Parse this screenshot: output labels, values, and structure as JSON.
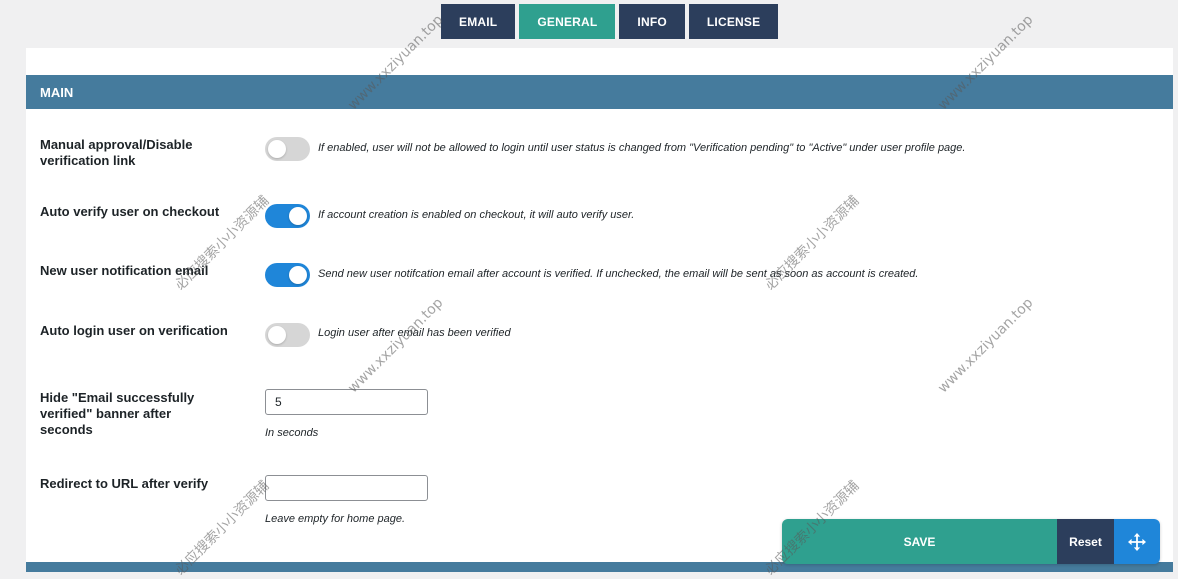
{
  "tabs": [
    {
      "label": "EMAIL",
      "active": false
    },
    {
      "label": "GENERAL",
      "active": true
    },
    {
      "label": "INFO",
      "active": false
    },
    {
      "label": "LICENSE",
      "active": false
    }
  ],
  "section": {
    "title": "MAIN"
  },
  "settings": {
    "manual_approval": {
      "label": "Manual approval/Disable verification link",
      "enabled": false,
      "description": "If enabled, user will not be allowed to login until user status is changed from \"Verification pending\" to \"Active\" under user profile page."
    },
    "auto_verify": {
      "label": "Auto verify user on checkout",
      "enabled": true,
      "description": "If account creation is enabled on checkout, it will auto verify user."
    },
    "new_user_notification": {
      "label": "New user notification email",
      "enabled": true,
      "description": "Send new user notifcation email after account is verified. If unchecked, the email will be sent as soon as account is created."
    },
    "auto_login": {
      "label": "Auto login user on verification",
      "enabled": false,
      "description": "Login user after email has been verified"
    },
    "hide_banner": {
      "label": "Hide \"Email successfully verified\" banner after seconds",
      "value": "5",
      "hint": "In seconds"
    },
    "redirect_url": {
      "label": "Redirect to URL after verify",
      "value": "",
      "hint": "Leave empty for home page."
    }
  },
  "actions": {
    "save_label": "SAVE",
    "reset_label": "Reset",
    "move_icon": "move-arrows-icon"
  },
  "watermarks": {
    "site": "www.xxziyuan.top",
    "cn": "必应搜索小小资源辅"
  },
  "colors": {
    "tab": "#2c3e5c",
    "tab_active": "#2fa08f",
    "section_header": "#457b9d",
    "toggle_on": "#1f86d9",
    "toggle_off": "#d6d6d6",
    "save": "#2fa08f"
  }
}
